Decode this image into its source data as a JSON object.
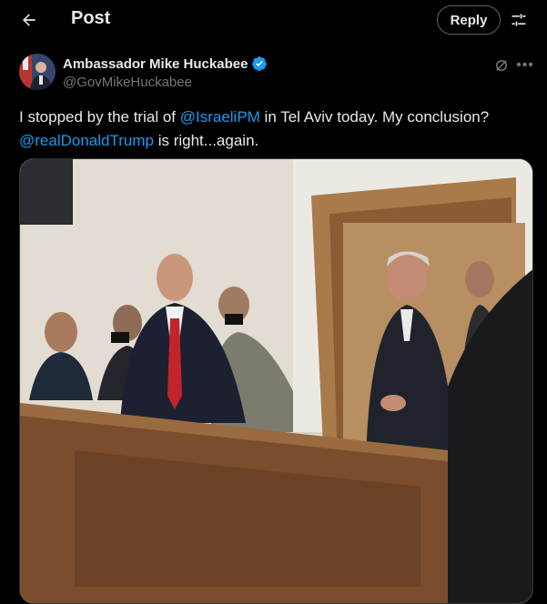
{
  "header": {
    "title": "Post",
    "reply_label": "Reply"
  },
  "tweet": {
    "author_name": "Ambassador Mike Huckabee",
    "handle": "@GovMikeHuckabee",
    "text_part1": "I stopped by the trial of ",
    "mention1": "@IsraeliPM",
    "text_part2": " in Tel Aviv today.  My conclusion? ",
    "mention2": "@realDonaldTrump",
    "text_part3": " is right...again."
  },
  "colors": {
    "background": "#000000",
    "text": "#e7e9ea",
    "secondary_text": "#71767b",
    "link": "#1d9bf0",
    "verified_badge": "#1d9bf0",
    "border": "#2f3336"
  },
  "icons": {
    "back": "arrow-left-icon",
    "settings": "sliders-icon",
    "verified": "verified-badge-icon",
    "grok": "grok-icon",
    "more": "more-horizontal-icon"
  }
}
